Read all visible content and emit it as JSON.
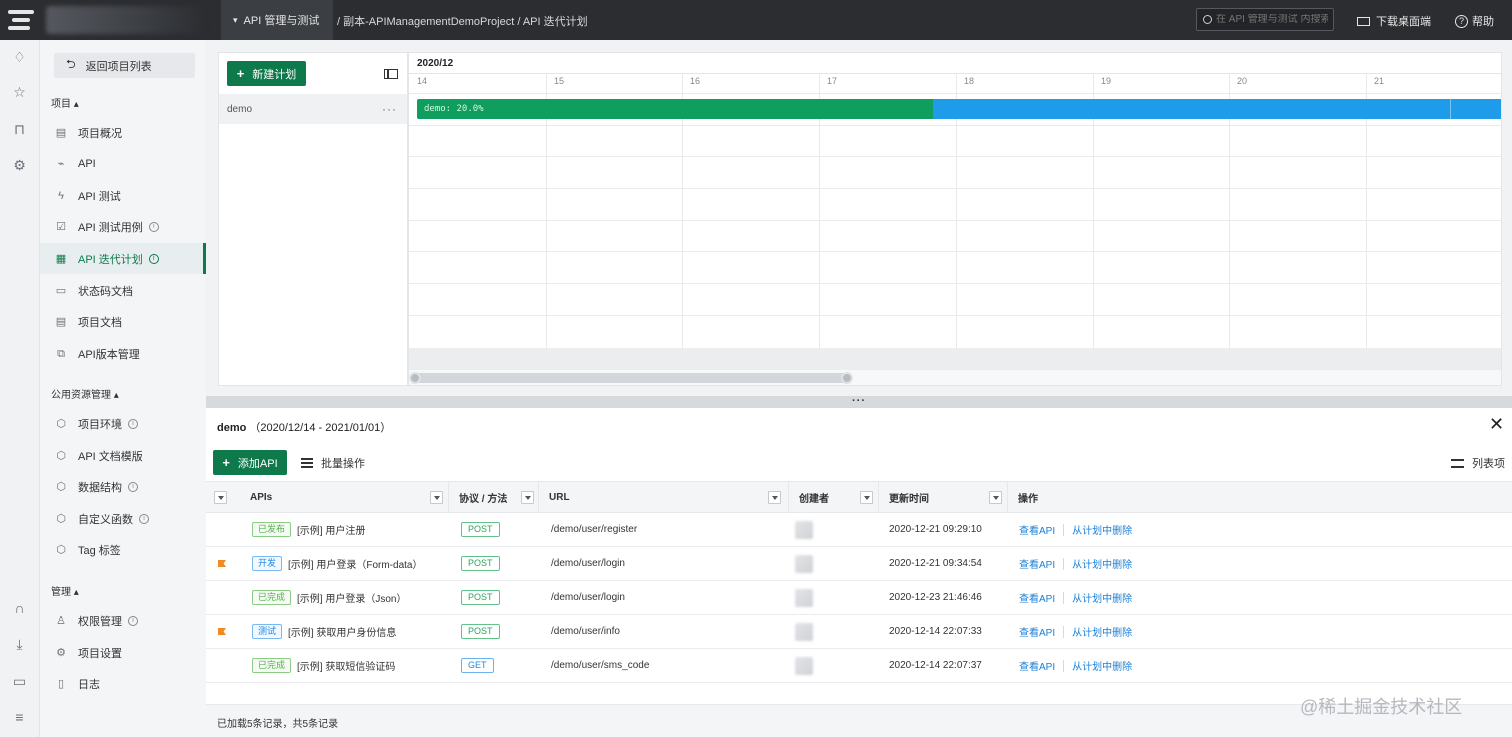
{
  "topbar": {
    "module": "API 管理与测试",
    "breadcrumb": "/ 副本-APIManagementDemoProject / API 迭代计划",
    "search_placeholder": "在 API 管理与测试 内搜索",
    "download": "下载桌面端",
    "help": "帮助"
  },
  "rail": {
    "icons": [
      "bell-icon",
      "star-icon",
      "shirt-icon",
      "gear-icon",
      "headset-icon",
      "download-icon",
      "keyboard-icon",
      "menu-icon"
    ]
  },
  "sidebar": {
    "back": "返回项目列表",
    "sections": [
      {
        "title": "项目 ▴"
      },
      {
        "title": "公用资源管理 ▴"
      },
      {
        "title": "管理 ▴"
      }
    ],
    "project_items": [
      {
        "label": "项目概况",
        "icon": "overview-icon"
      },
      {
        "label": "API",
        "icon": "api-icon"
      },
      {
        "label": "API 测试",
        "icon": "bolt-icon"
      },
      {
        "label": "API 测试用例",
        "icon": "testcase-icon"
      },
      {
        "label": "API 迭代计划",
        "icon": "plan-icon"
      },
      {
        "label": "状态码文档",
        "icon": "doc-icon"
      },
      {
        "label": "项目文档",
        "icon": "doc2-icon"
      },
      {
        "label": "API版本管理",
        "icon": "version-icon"
      }
    ],
    "resource_items": [
      {
        "label": "项目环境",
        "icon": "cube-icon"
      },
      {
        "label": "API 文档模版",
        "icon": "cube-icon"
      },
      {
        "label": "数据结构",
        "icon": "cube-icon"
      },
      {
        "label": "自定义函数",
        "icon": "cube-icon"
      },
      {
        "label": "Tag 标签",
        "icon": "cube-icon"
      }
    ],
    "manage_items": [
      {
        "label": "权限管理",
        "icon": "user-icon"
      },
      {
        "label": "项目设置",
        "icon": "gear-icon"
      },
      {
        "label": "日志",
        "icon": "log-icon"
      }
    ],
    "active": "API 迭代计划"
  },
  "gantt": {
    "new_plan": "新建计划",
    "plans": [
      {
        "name": "demo",
        "more": "···"
      }
    ],
    "month": "2020/12",
    "days": [
      "14",
      "15",
      "16",
      "17",
      "18",
      "19",
      "20",
      "21"
    ],
    "bar_label": "demo: 20.0%",
    "progress": 0.2,
    "colors": {
      "done": "#0f9e5e",
      "remaining": "#1e9be9"
    }
  },
  "detail": {
    "title": "demo",
    "range": "（2020/12/14 - 2021/01/01）",
    "close": "✕",
    "add_api": "添加API",
    "batch": "批量操作",
    "columns_btn": "列表项",
    "headers": {
      "apis": "APIs",
      "protocol": "协议 / 方法",
      "url": "URL",
      "creator": "创建者",
      "updated": "更新时间",
      "ops": "操作"
    },
    "rows": [
      {
        "flag": false,
        "status": "已发布",
        "status_color": "green",
        "name": "[示例] 用户注册",
        "method": "POST",
        "url": "/demo/user/register",
        "updated": "2020-12-21 09:29:10",
        "view": "查看API",
        "remove": "从计划中删除"
      },
      {
        "flag": true,
        "status": "开发",
        "status_color": "blue",
        "name": "[示例] 用户登录（Form-data）",
        "method": "POST",
        "url": "/demo/user/login",
        "updated": "2020-12-21 09:34:54",
        "view": "查看API",
        "remove": "从计划中删除"
      },
      {
        "flag": false,
        "status": "已完成",
        "status_color": "green",
        "name": "[示例] 用户登录（Json）",
        "method": "POST",
        "url": "/demo/user/login",
        "updated": "2020-12-23 21:46:46",
        "view": "查看API",
        "remove": "从计划中删除"
      },
      {
        "flag": true,
        "status": "测试",
        "status_color": "blue",
        "name": "[示例] 获取用户身份信息",
        "method": "POST",
        "url": "/demo/user/info",
        "updated": "2020-12-14 22:07:33",
        "view": "查看API",
        "remove": "从计划中删除"
      },
      {
        "flag": false,
        "status": "已完成",
        "status_color": "green",
        "name": "[示例] 获取短信验证码",
        "method": "GET",
        "url": "/demo/user/sms_code",
        "updated": "2020-12-14 22:07:37",
        "view": "查看API",
        "remove": "从计划中删除"
      }
    ],
    "footer": "已加载5条记录，共5条记录"
  },
  "watermark": "@稀土掘金技术社区"
}
